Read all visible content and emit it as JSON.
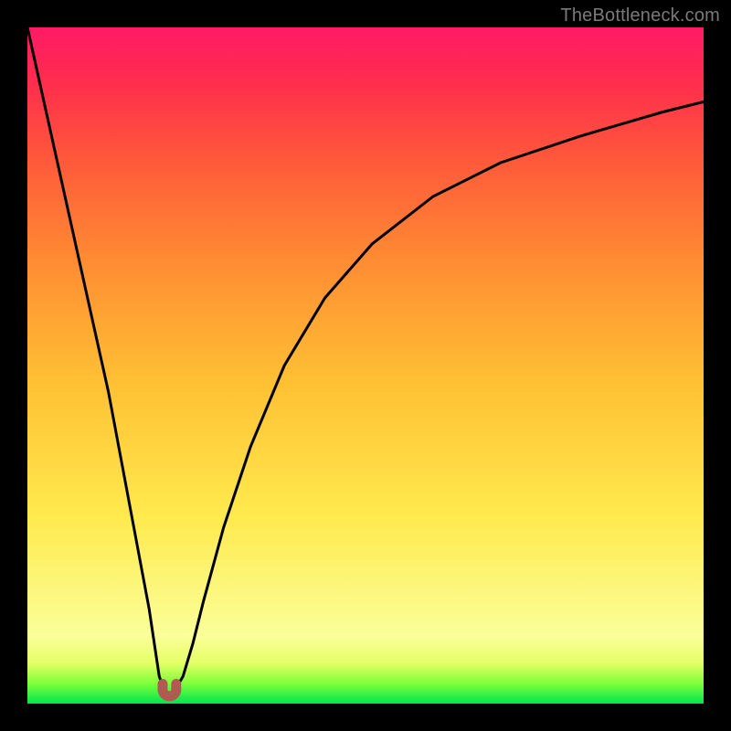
{
  "watermark": "TheBottleneck.com",
  "chart_data": {
    "type": "line",
    "title": "",
    "xlabel": "",
    "ylabel": "",
    "xlim": [
      0,
      100
    ],
    "ylim": [
      0,
      100
    ],
    "grid": false,
    "series": [
      {
        "name": "bottleneck-curve",
        "color": "#000000",
        "x": [
          0,
          4,
          8,
          12,
          15,
          18,
          19.5,
          20.5,
          21.5,
          23,
          24.5,
          26,
          29,
          33,
          38,
          44,
          51,
          60,
          70,
          82,
          94,
          100
        ],
        "y": [
          100,
          82,
          64,
          46,
          30,
          14,
          4,
          1.5,
          1.5,
          4,
          9,
          15,
          26,
          38,
          50,
          60,
          68,
          75,
          80,
          84,
          87.5,
          89
        ]
      }
    ],
    "markers": [
      {
        "name": "curve-dip-left",
        "x": 20.0,
        "y": 1.3,
        "color": "#b05a52"
      },
      {
        "name": "curve-dip-right",
        "x": 22.0,
        "y": 1.3,
        "color": "#b05a52"
      }
    ],
    "gradient_stops": [
      {
        "pos": 0,
        "color": "#00e64d"
      },
      {
        "pos": 3,
        "color": "#7fff3a"
      },
      {
        "pos": 6,
        "color": "#e6ff66"
      },
      {
        "pos": 10,
        "color": "#faff99"
      },
      {
        "pos": 28,
        "color": "#ffe94d"
      },
      {
        "pos": 48,
        "color": "#ffbf33"
      },
      {
        "pos": 66,
        "color": "#ff8a33"
      },
      {
        "pos": 80,
        "color": "#ff5a3a"
      },
      {
        "pos": 92,
        "color": "#ff2d4d"
      },
      {
        "pos": 100,
        "color": "#ff1a66"
      }
    ]
  }
}
